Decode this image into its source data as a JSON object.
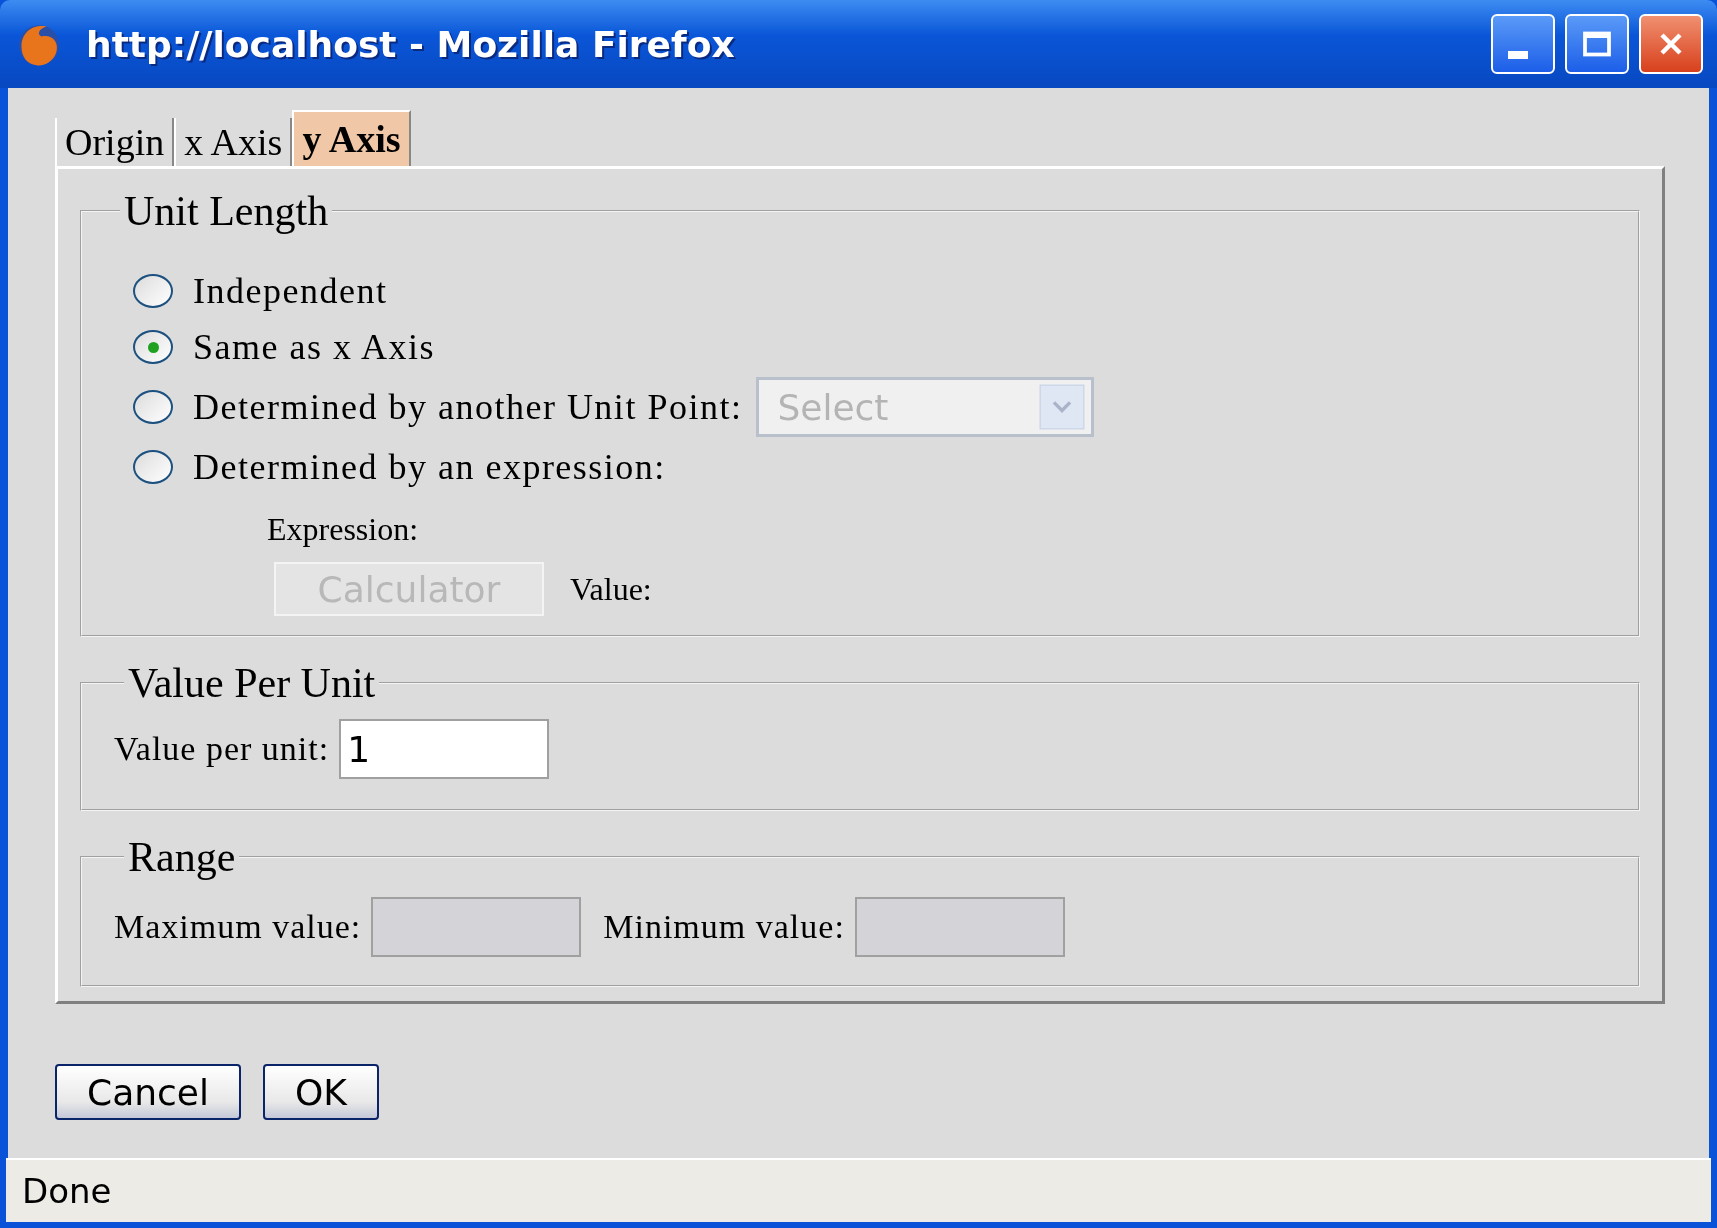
{
  "window": {
    "title": "http://localhost - Mozilla Firefox"
  },
  "tabs": [
    {
      "label": "Origin",
      "selected": false
    },
    {
      "label": "x Axis",
      "selected": false
    },
    {
      "label": "y Axis",
      "selected": true
    }
  ],
  "unit_length": {
    "legend": "Unit Length",
    "options": [
      {
        "label": "Independent",
        "selected": false,
        "kind": "plain"
      },
      {
        "label": "Same as x Axis",
        "selected": true,
        "kind": "plain"
      },
      {
        "label": "Determined by another Unit Point:",
        "selected": false,
        "kind": "select",
        "select": {
          "placeholder": "Select",
          "disabled": true
        }
      },
      {
        "label": "Determined by an expression:",
        "selected": false,
        "kind": "plain"
      }
    ],
    "expression_label": "Expression:",
    "calculator_button": {
      "label": "Calculator",
      "disabled": true
    },
    "value_label": "Value:"
  },
  "value_per_unit": {
    "legend": "Value Per Unit",
    "label": "Value per unit:",
    "value": "1"
  },
  "range": {
    "legend": "Range",
    "fields": [
      {
        "label": "Maximum value:",
        "disabled": true
      },
      {
        "label": "Minimum value:",
        "disabled": true
      }
    ]
  },
  "buttons": [
    "Cancel",
    "OK"
  ],
  "status_bar": "Done"
}
